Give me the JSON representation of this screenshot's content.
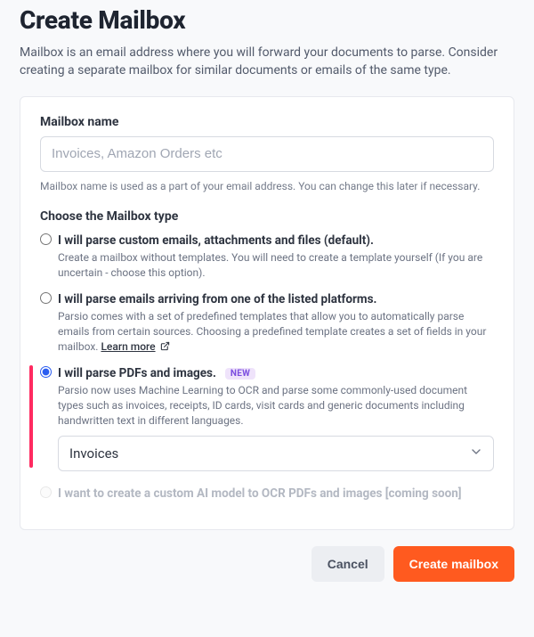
{
  "header": {
    "title": "Create Mailbox",
    "subtitle": "Mailbox is an email address where you will forward your documents to parse. Consider creating a separate mailbox for similar documents or emails of the same type."
  },
  "mailbox_name": {
    "label": "Mailbox name",
    "placeholder": "Invoices, Amazon Orders etc",
    "value": "",
    "hint": "Mailbox name is used as a part of your email address. You can change this later if necessary."
  },
  "type_section": {
    "label": "Choose the Mailbox type",
    "options": [
      {
        "id": "custom",
        "title": "I will parse custom emails, attachments and files (default).",
        "desc": "Create a mailbox without templates. You will need to create a template yourself (If you are uncertain - choose this option).",
        "selected": false,
        "disabled": false
      },
      {
        "id": "platforms",
        "title": "I will parse emails arriving from one of the listed platforms.",
        "desc": "Parsio comes with a set of predefined templates that allow you to automatically parse emails from certain sources. Choosing a predefined template creates a set of fields in your mailbox.",
        "learn_more": "Learn more",
        "selected": false,
        "disabled": false
      },
      {
        "id": "pdfs",
        "title": "I will parse PDFs and images.",
        "badge": "NEW",
        "desc": "Parsio now uses Machine Learning to OCR and parse some commonly-used document types such as invoices, receipts, ID cards, visit cards and generic documents including handwritten text in different languages.",
        "select_value": "Invoices",
        "selected": true,
        "disabled": false
      },
      {
        "id": "custom-ai",
        "title": "I want to create a custom AI model to OCR PDFs and images [coming soon]",
        "desc": "",
        "selected": false,
        "disabled": true
      }
    ]
  },
  "buttons": {
    "cancel": "Cancel",
    "create": "Create mailbox"
  }
}
